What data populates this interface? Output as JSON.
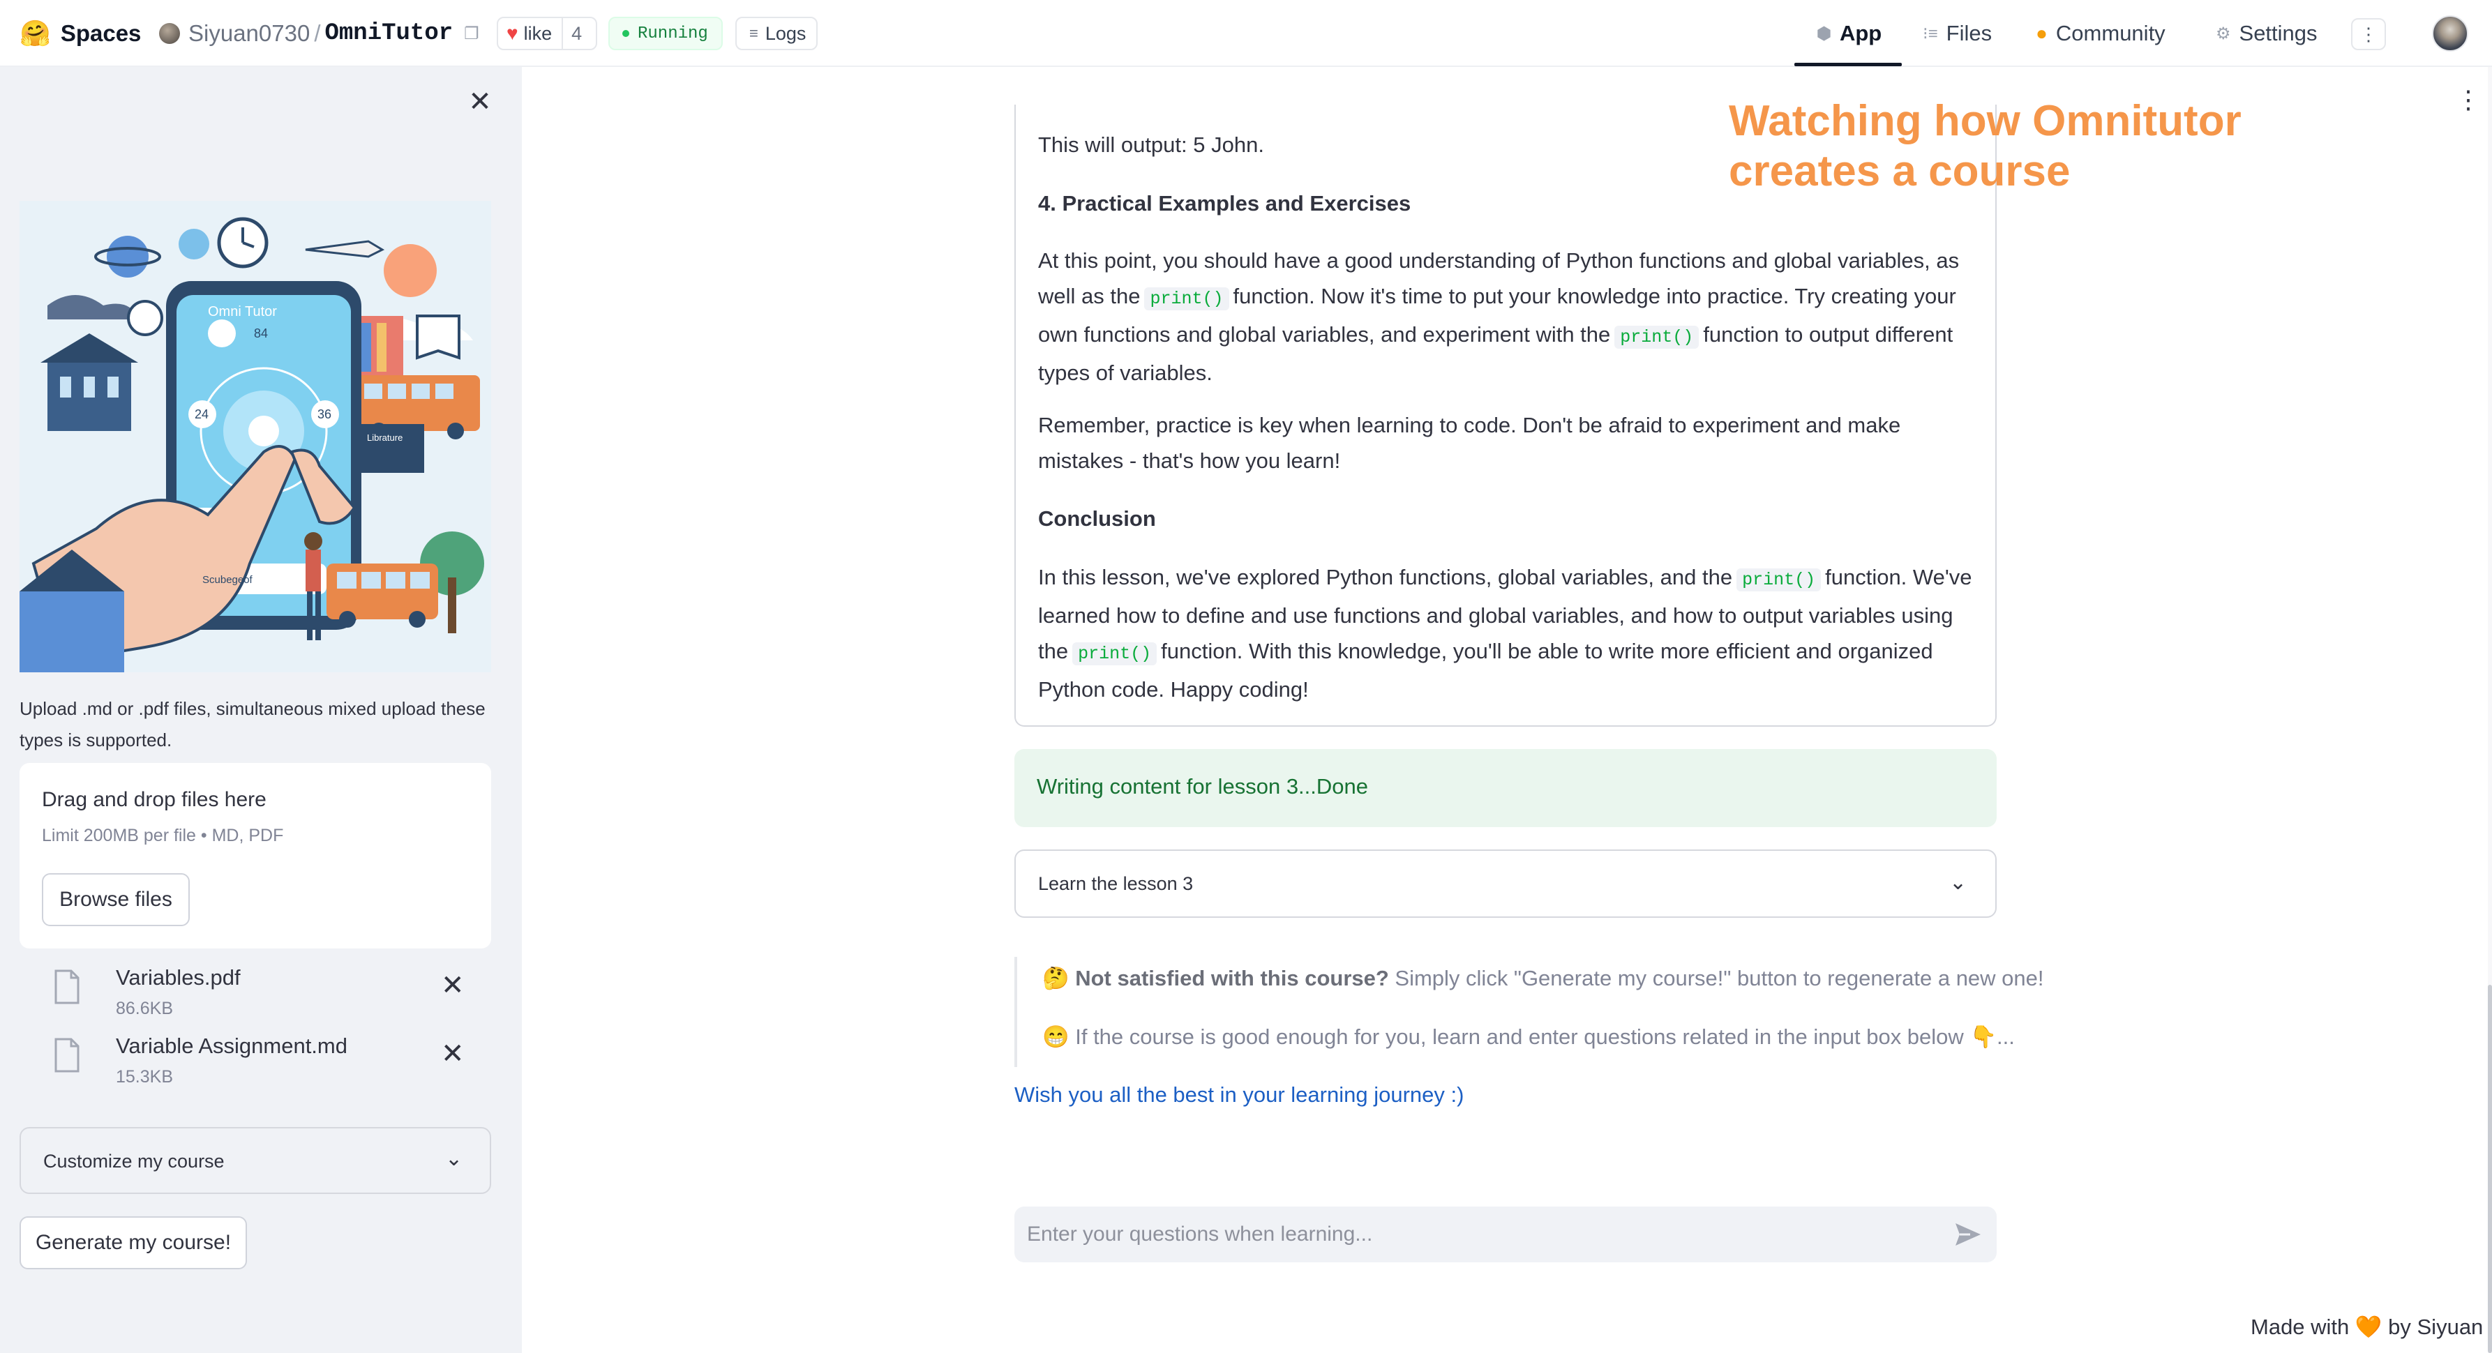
{
  "topnav": {
    "spaces_emoji": "🤗",
    "spaces_label": "Spaces",
    "owner": "Siyuan0730",
    "slash": "/",
    "repo_name": "OmniTutor",
    "like_label": "like",
    "like_count": "4",
    "status": "Running",
    "logs_label": "Logs",
    "tabs": [
      {
        "label": "App",
        "icon": "cube-icon",
        "active": true
      },
      {
        "label": "Files",
        "icon": "files-icon"
      },
      {
        "label": "Community",
        "icon": "community-icon"
      },
      {
        "label": "Settings",
        "icon": "gear-icon"
      }
    ],
    "more_glyph": "⋮"
  },
  "sidebar": {
    "close_glyph": "✕",
    "hero": {
      "title": "Omni Tutor",
      "badge_84": "84",
      "badge_24": "24",
      "badge_36": "36",
      "library_label": "Librature",
      "app_label": "Scubegeof"
    },
    "upload_help": "Upload .md or .pdf files, simultaneous mixed upload these types is supported.",
    "dropzone": {
      "title": "Drag and drop files here",
      "limit": "Limit 200MB per file • MD, PDF",
      "browse_label": "Browse files"
    },
    "files": [
      {
        "name": "Variables.pdf",
        "size": "86.6KB"
      },
      {
        "name": "Variable Assignment.md",
        "size": "15.3KB"
      }
    ],
    "remove_glyph": "✕",
    "customize_label": "Customize my course",
    "chevron_glyph": "⌄",
    "generate_label": "Generate my course!"
  },
  "main": {
    "more_glyph": "⋮",
    "overlay_title": "Watching how Omnitutor creates a course",
    "content": {
      "output_line": "This will output: 5 John.",
      "section4_heading": "4. Practical Examples and Exercises",
      "p1_a": "At this point, you should have a good understanding of Python functions and global variables, as well as the",
      "p1_code1": "print()",
      "p1_b": "function. Now it's time to put your knowledge into practice. Try creating your own functions and global variables, and experiment with the",
      "p1_code2": "print()",
      "p1_c": "function to output different types of variables.",
      "p2": "Remember, practice is key when learning to code. Don't be afraid to experiment and make mistakes - that's how you learn!",
      "conclusion_heading": "Conclusion",
      "p3_a": "In this lesson, we've explored Python functions, global variables, and the",
      "p3_code1": "print()",
      "p3_b": "function. We've learned how to define and use functions and global variables, and how to output variables using the",
      "p3_code2": "print()",
      "p3_c": "function. With this knowledge, you'll be able to write more efficient and organized Python code. Happy coding!"
    },
    "status_done": "Writing content for lesson 3...Done",
    "lesson_expander": "Learn the lesson 3",
    "notes": {
      "n1_emoji": "🤔",
      "n1_bold": "Not satisfied with this course?",
      "n1_rest": "Simply click \"Generate my course!\" button to regenerate a new one!",
      "n2_emoji": "😁",
      "n2_text": "If the course is good enough for you, learn and enter questions related in the input box below",
      "n2_tail": "👇..."
    },
    "wish": "Wish you all the best in your learning journey :)",
    "chat_placeholder": "Enter your questions when learning..."
  },
  "footer": {
    "made_with": "Made with",
    "heart": "🧡",
    "by": "by Siyuan"
  },
  "colors": {
    "accent_orange": "#f5964a",
    "sidebar_bg": "#f0f2f6",
    "success_bg": "#eaf6ee",
    "success_text": "#177233",
    "link": "#1c5fc4",
    "code": "#09ab3b"
  }
}
